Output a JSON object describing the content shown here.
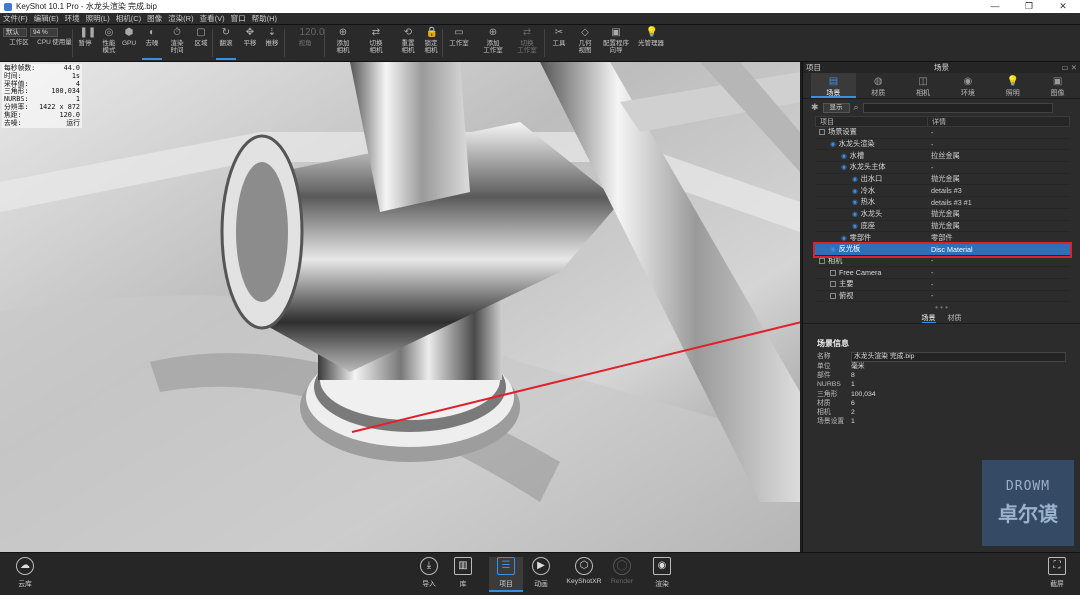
{
  "window": {
    "title": "KeyShot 10.1 Pro  - 水龙头渲染 完成.bip",
    "controls": [
      "—",
      "❐",
      "✕"
    ]
  },
  "menu": [
    "文件(F)",
    "编辑(E)",
    "环境",
    "照明(L)",
    "相机(C)",
    "图像",
    "渲染(R)",
    "查看(V)",
    "窗口",
    "帮助(H)"
  ],
  "toolbar": {
    "workspace_label": "默认",
    "zoom_value": "94 %",
    "items": [
      {
        "label": "工作区",
        "icon": "▦"
      },
      {
        "label": "CPU",
        "icon": "CPU"
      },
      {
        "label": "使用量",
        "icon": "◔"
      },
      {
        "label": "暂停",
        "icon": "❚❚"
      },
      {
        "label": "性能\n模式",
        "icon": "◎"
      },
      {
        "label": "GPU",
        "icon": "⬢"
      },
      {
        "label": "去噪",
        "icon": "◐"
      },
      {
        "label": "渲染\n时间",
        "icon": "⏱"
      },
      {
        "label": "区域",
        "icon": "▢"
      },
      {
        "label": "翻滚",
        "icon": "↻"
      },
      {
        "label": "平移",
        "icon": "✥"
      },
      {
        "label": "推移",
        "icon": "⇣"
      },
      {
        "label": "视角",
        "icon": "120.0"
      },
      {
        "label": "添加\n相机",
        "icon": "⊕"
      },
      {
        "label": "切换\n相机",
        "icon": "⇄"
      },
      {
        "label": "重置\n相机",
        "icon": "⟲"
      },
      {
        "label": "锁定\n相机",
        "icon": "🔒"
      },
      {
        "label": "工作室",
        "icon": "▭"
      },
      {
        "label": "添加\n工作室",
        "icon": "⊕"
      },
      {
        "label": "切换\n工作室",
        "icon": "⇄"
      },
      {
        "label": "工具",
        "icon": "✂"
      },
      {
        "label": "几何\n视图",
        "icon": "◇"
      },
      {
        "label": "配置程序\n向导",
        "icon": "▣"
      },
      {
        "label": "光管理器",
        "icon": "💡"
      }
    ]
  },
  "stats": [
    {
      "k": "每秒帧数:",
      "v": "44.0"
    },
    {
      "k": "时间:",
      "v": "1s"
    },
    {
      "k": "采样值:",
      "v": "4"
    },
    {
      "k": "三角形:",
      "v": "100,034"
    },
    {
      "k": "NURBS:",
      "v": "1"
    },
    {
      "k": "分辨率:",
      "v": "1422 x 872"
    },
    {
      "k": "焦距:",
      "v": "120.0"
    },
    {
      "k": "去噪:",
      "v": "运行"
    }
  ],
  "panel": {
    "title_left": "项目",
    "title": "场景",
    "tabs": [
      {
        "label": "场景",
        "icon": "▤"
      },
      {
        "label": "材质",
        "icon": "◍"
      },
      {
        "label": "相机",
        "icon": "◫"
      },
      {
        "label": "环境",
        "icon": "◉"
      },
      {
        "label": "照明",
        "icon": "💡"
      },
      {
        "label": "图像",
        "icon": "▣"
      }
    ],
    "show_button": "显示",
    "search_icon": "search-icon",
    "columns": [
      "项目",
      "详情"
    ],
    "tree": [
      {
        "indent": 0,
        "name": "场景设置",
        "detail": "-"
      },
      {
        "indent": 1,
        "name": "水龙头渲染",
        "detail": "-"
      },
      {
        "indent": 2,
        "name": "水槽",
        "detail": "拉丝金属"
      },
      {
        "indent": 2,
        "name": "水龙头主体",
        "detail": "-"
      },
      {
        "indent": 3,
        "name": "出水口",
        "detail": "抛光金属"
      },
      {
        "indent": 3,
        "name": "冷水",
        "detail": "details #3"
      },
      {
        "indent": 3,
        "name": "热水",
        "detail": "details #3 #1"
      },
      {
        "indent": 3,
        "name": "水龙头",
        "detail": "抛光金属"
      },
      {
        "indent": 3,
        "name": "底座",
        "detail": "抛光金属"
      },
      {
        "indent": 2,
        "name": "零部件",
        "detail": "零部件"
      },
      {
        "indent": 1,
        "name": "反光板",
        "detail": "Disc Material"
      },
      {
        "indent": 0,
        "name": "相机",
        "detail": "-"
      },
      {
        "indent": 1,
        "name": "Free Camera",
        "detail": "-"
      },
      {
        "indent": 1,
        "name": "主要",
        "detail": "-"
      },
      {
        "indent": 1,
        "name": "俯视",
        "detail": "-"
      }
    ],
    "subtabs": [
      "场景",
      "材质"
    ],
    "info_title": "场景信息",
    "info": [
      {
        "k": "名称",
        "v": "水龙头渲染 完成.bip"
      },
      {
        "k": "单位",
        "v": "毫米"
      },
      {
        "k": "部件",
        "v": "8"
      },
      {
        "k": "NURBS",
        "v": "1"
      },
      {
        "k": "三角形",
        "v": "100,034"
      },
      {
        "k": "材质",
        "v": "6"
      },
      {
        "k": "相机",
        "v": "2"
      },
      {
        "k": "场景设置",
        "v": "1"
      }
    ],
    "watermark": {
      "top": "DROWM",
      "bottom": "卓尔谟"
    }
  },
  "bottombar": {
    "left": {
      "label": "云库",
      "icon": "cloud-icon"
    },
    "items": [
      {
        "label": "导入",
        "icon": "import-icon"
      },
      {
        "label": "库",
        "icon": "library-icon"
      },
      {
        "label": "项目",
        "icon": "project-icon"
      },
      {
        "label": "动画",
        "icon": "animation-icon"
      },
      {
        "label": "KeyShotXR",
        "icon": "keyshotxr-icon"
      },
      {
        "label": "Render",
        "icon": "render-icon"
      },
      {
        "label": "渲染",
        "icon": "camera-icon"
      }
    ],
    "right": {
      "label": "截屏",
      "icon": "screenshot-icon"
    }
  },
  "colors": {
    "accent": "#3d8ee0",
    "selection": "#2f6fb8",
    "highlight": "#e0202a"
  }
}
